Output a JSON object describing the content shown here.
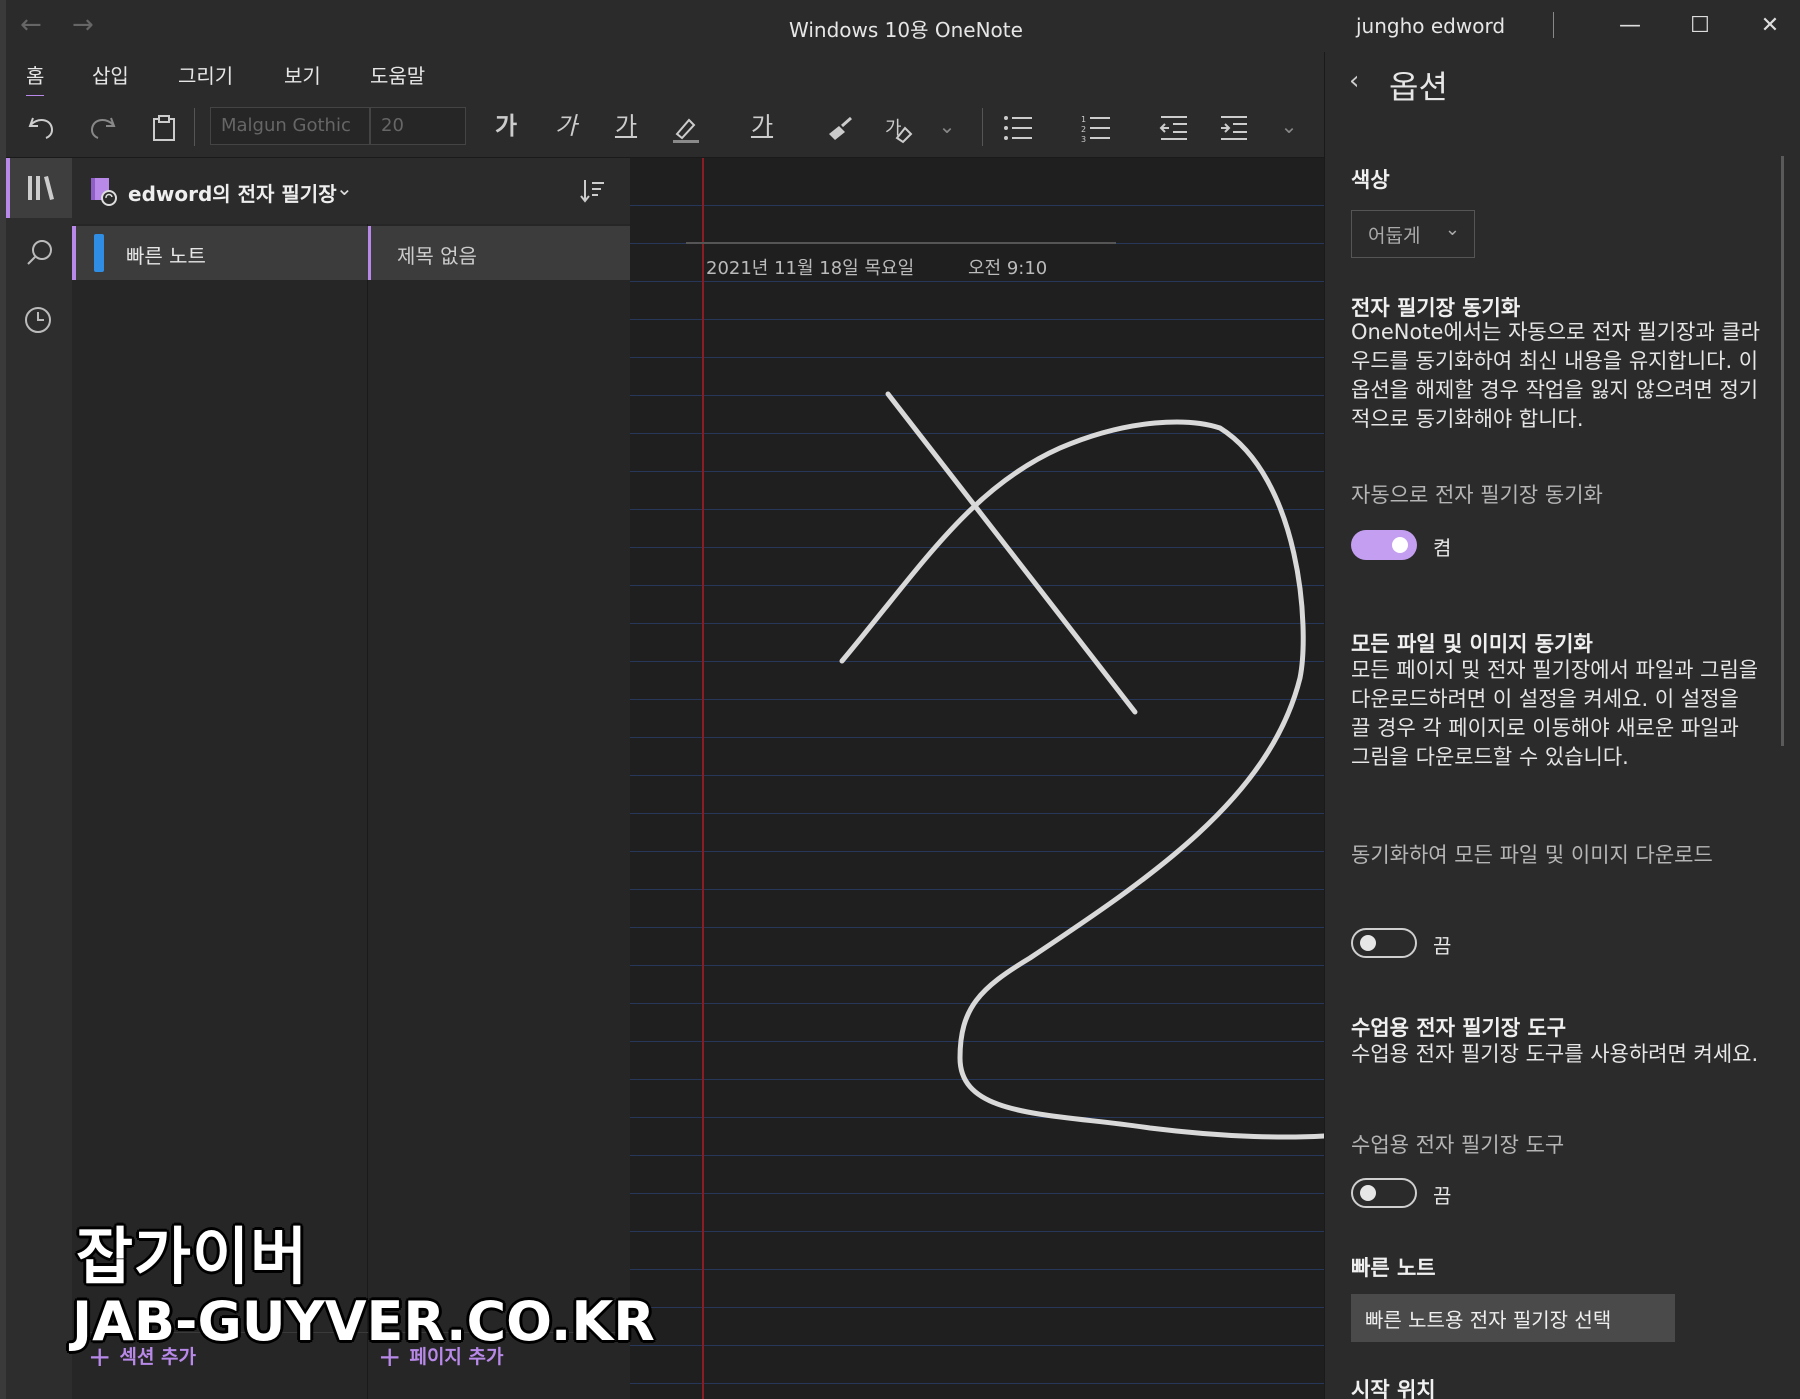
{
  "window": {
    "title": "Windows 10용 OneNote",
    "user": "jungho edword",
    "back_arrow": "←",
    "forward_arrow": "→",
    "minimize": "—",
    "maximize": "☐",
    "close": "✕"
  },
  "ribbon": {
    "tabs": [
      {
        "label": "홈",
        "active": true
      },
      {
        "label": "삽입"
      },
      {
        "label": "그리기"
      },
      {
        "label": "보기"
      },
      {
        "label": "도움말"
      }
    ],
    "font_name": "Malgun Gothic",
    "font_size": "20",
    "bold": "가",
    "italic": "가",
    "underline": "가",
    "font_color": "가",
    "style_dropdown": "⌄",
    "paragraph_dropdown": "⌄"
  },
  "notebook": {
    "name": "edword의 전자 필기장",
    "chevron": "⌄",
    "sections": [
      {
        "label": "빠른 노트",
        "color": "#2f8de4"
      }
    ],
    "pages": [
      {
        "label": "제목 없음"
      }
    ],
    "add_section": "섹션 추가",
    "add_page": "페이지 추가",
    "plus": "+"
  },
  "page": {
    "date": "2021년 11월 18일 목요일",
    "time": "오전 9:10"
  },
  "options": {
    "back": "‹",
    "title": "옵션",
    "color_heading": "색상",
    "color_value": "어둡게",
    "chevron": "⌄",
    "sync_heading": "전자 필기장 동기화",
    "sync_desc": "OneNote에서는 자동으로 전자 필기장과 클라우드를 동기화하여 최신 내용을 유지합니다. 이 옵션을 해제할 경우 작업을 잃지 않으려면 정기적으로 동기화해야 합니다.",
    "auto_sync_label": "자동으로 전자 필기장 동기화",
    "auto_sync_state": "켬",
    "files_heading": "모든 파일 및 이미지 동기화",
    "files_desc": "모든 페이지 및 전자 필기장에서 파일과 그림을 다운로드하려면 이 설정을 켜세요. 이 설정을 끌 경우 각 페이지로 이동해야 새로운 파일과 그림을 다운로드할 수 있습니다.",
    "files_label": "동기화하여 모든 파일 및 이미지 다운로드",
    "files_state": "끔",
    "class_heading": "수업용 전자 필기장 도구",
    "class_desc": "수업용 전자 필기장 도구를 사용하려면 켜세요.",
    "class_label": "수업용 전자 필기장 도구",
    "class_state": "끔",
    "quick_heading": "빠른 노트",
    "quick_button": "빠른 노트용 전자 필기장 선택",
    "next_heading_partial": "시작 위치"
  },
  "watermark": {
    "line1": "잡가이버",
    "line2": "JAB-GUYVER.CO.KR"
  },
  "colors": {
    "accent": "#b889e8",
    "section_blue": "#2f8de4",
    "margin_red": "#8a1c24"
  }
}
